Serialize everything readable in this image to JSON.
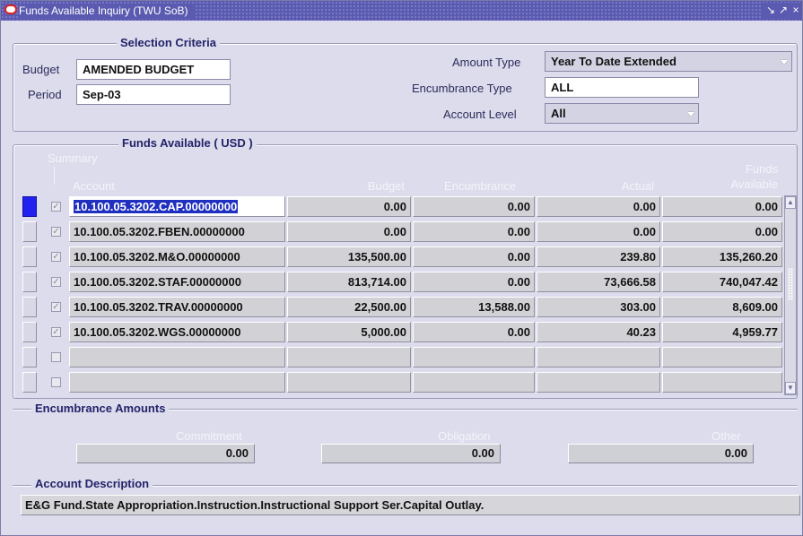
{
  "window": {
    "title": "Funds Available Inquiry (TWU SoB)",
    "title_controls": [
      "↘",
      "↗",
      "×"
    ]
  },
  "selection_criteria": {
    "title": "Selection Criteria",
    "budget_label": "Budget",
    "budget_value": "AMENDED BUDGET",
    "period_label": "Period",
    "period_value": "Sep-03",
    "amount_type_label": "Amount Type",
    "amount_type_value": "Year To Date Extended",
    "encumbrance_type_label": "Encumbrance Type",
    "encumbrance_type_value": "ALL",
    "account_level_label": "Account Level",
    "account_level_value": "All"
  },
  "funds_available": {
    "title": "Funds Available ( USD )",
    "summary_label": "Summary",
    "headers": {
      "account": "Account",
      "budget": "Budget",
      "encumbrance": "Encumbrance",
      "actual": "Actual",
      "funds_line1": "Funds",
      "funds_line2": "Available"
    },
    "rows": [
      {
        "account": "10.100.05.3202.CAP.00000000",
        "budget": "0.00",
        "encumbrance": "0.00",
        "actual": "0.00",
        "funds": "0.00"
      },
      {
        "account": "10.100.05.3202.FBEN.00000000",
        "budget": "0.00",
        "encumbrance": "0.00",
        "actual": "0.00",
        "funds": "0.00"
      },
      {
        "account": "10.100.05.3202.M&O.00000000",
        "budget": "135,500.00",
        "encumbrance": "0.00",
        "actual": "239.80",
        "funds": "135,260.20"
      },
      {
        "account": "10.100.05.3202.STAF.00000000",
        "budget": "813,714.00",
        "encumbrance": "0.00",
        "actual": "73,666.58",
        "funds": "740,047.42"
      },
      {
        "account": "10.100.05.3202.TRAV.00000000",
        "budget": "22,500.00",
        "encumbrance": "13,588.00",
        "actual": "303.00",
        "funds": "8,609.00"
      },
      {
        "account": "10.100.05.3202.WGS.00000000",
        "budget": "5,000.00",
        "encumbrance": "0.00",
        "actual": "40.23",
        "funds": "4,959.77"
      },
      {
        "account": "",
        "budget": "",
        "encumbrance": "",
        "actual": "",
        "funds": ""
      },
      {
        "account": "",
        "budget": "",
        "encumbrance": "",
        "actual": "",
        "funds": ""
      }
    ]
  },
  "encumbrance_amounts": {
    "title": "Encumbrance Amounts",
    "commitment_label": "Commitment",
    "commitment_value": "0.00",
    "obligation_label": "Obligation",
    "obligation_value": "0.00",
    "other_label": "Other",
    "other_value": "0.00"
  },
  "account_description": {
    "title": "Account Description",
    "value": "E&G Fund.State Appropriation.Instruction.Instructional Support Ser.Capital Outlay."
  },
  "colors": {
    "titlebar": "#5a5ab0",
    "panel": "#dcdcec",
    "selected_text": "#1f2fbf",
    "active_row_marker": "#2222ee"
  }
}
